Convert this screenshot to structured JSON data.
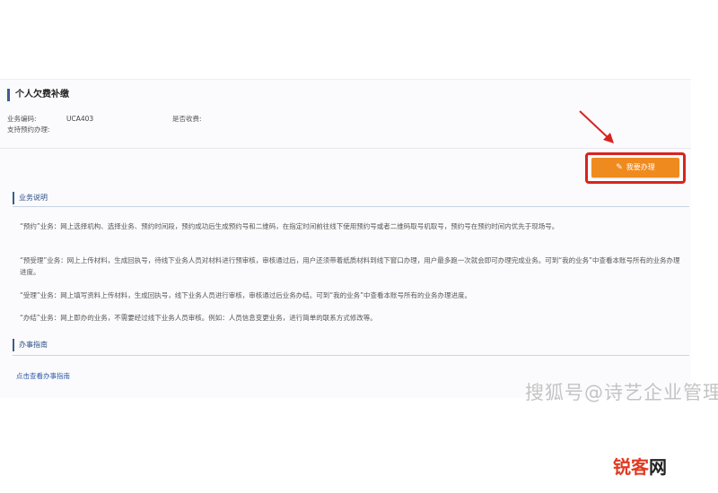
{
  "section": {
    "title": "个人欠费补缴"
  },
  "meta": {
    "code_label": "业务编码:",
    "code_value": "UCA403",
    "fee_label": "是否收费:",
    "fee_value": "",
    "appointment_label": "支持预约办理:",
    "appointment_value": ""
  },
  "apply_button": {
    "label": "我要办理",
    "icon": "pencil-icon"
  },
  "business_desc": {
    "heading": "业务说明",
    "paragraphs": [
      "“预约”业务：网上选择机构、选择业务、预约时间段，预约成功后生成预约号和二维码，在指定时间前往线下使用预约号或者二维码取号机取号，预约号在预约时间内优先于现场号。",
      "“预受理”业务：网上上传材料，生成回执号，待线下业务人员对材料进行预审核，审核通过后，用户还须带着纸质材料到线下窗口办理，用户最多跑一次就会即可办理完成业务。可到“我的业务”中查看本账号所有的业务办理进度。",
      "“受理”业务：网上填写资料上传材料，生成回执号，线下业务人员进行审核，审核通过后业务办结。可到“我的业务”中查看本账号所有的业务办理进度。",
      "“办结”业务：网上即办的业务，不需要经过线下业务人员审核。例如：人员信息变更业务，进行简单的联系方式修改等。"
    ]
  },
  "guide": {
    "heading": "办事指南",
    "link": "点击查看办事指南"
  },
  "watermark": "搜狐号@诗艺企业管理",
  "site_logo": {
    "part1": "锐客",
    "part2": "网"
  },
  "colors": {
    "accent_button": "#ef8a1f",
    "highlight_box": "#d9231f",
    "heading_blue": "#2d4f86"
  }
}
